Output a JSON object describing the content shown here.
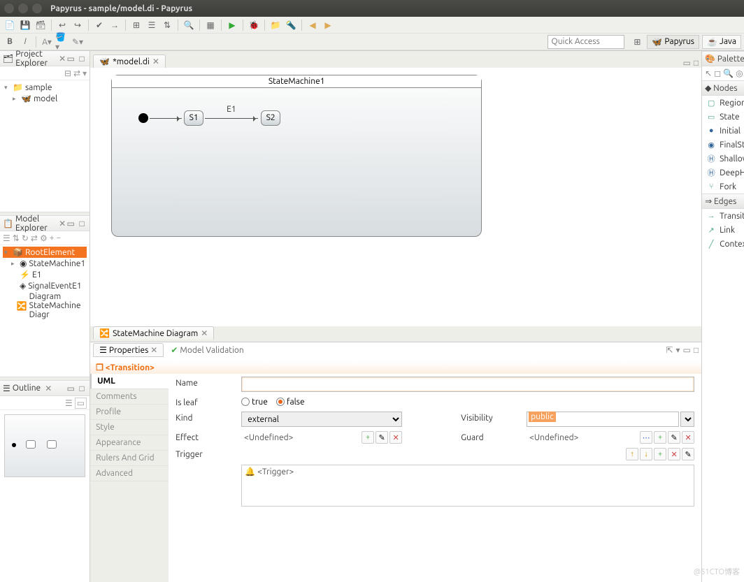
{
  "window": {
    "title": "Papyrus - sample/model.di - Papyrus"
  },
  "toolbar2": {
    "bold": "B",
    "italic": "I",
    "quick_access_placeholder": "Quick Access"
  },
  "perspectives": {
    "papyrus": "Papyrus",
    "java": "Java"
  },
  "project_explorer": {
    "title": "Project Explorer",
    "items": {
      "root": "sample",
      "child": "model"
    }
  },
  "model_explorer": {
    "title": "Model Explorer",
    "items": {
      "root": "RootElement",
      "sm": "StateMachine1",
      "e1": "E1",
      "sig": "SignalEventE1",
      "diag": "Diagram StateMachine Diagr"
    }
  },
  "outline": {
    "title": "Outline"
  },
  "editor": {
    "tab": "*model.di",
    "sm_title": "StateMachine1",
    "s1": "S1",
    "s2": "S2",
    "edge": "E1",
    "bottom_tab": "StateMachine Diagram"
  },
  "bottom": {
    "properties_tab": "Properties",
    "validation_tab": "Model Validation",
    "heading": "<Transition>",
    "cats": {
      "uml": "UML",
      "comments": "Comments",
      "profile": "Profile",
      "style": "Style",
      "appearance": "Appearance",
      "rulers": "Rulers And Grid",
      "advanced": "Advanced"
    },
    "form": {
      "name_label": "Name",
      "name_value": "",
      "isleaf_label": "Is leaf",
      "true_label": "true",
      "false_label": "false",
      "kind_label": "Kind",
      "kind_value": "external",
      "visibility_label": "Visibility",
      "visibility_value": "public",
      "effect_label": "Effect",
      "effect_value": "<Undefined>",
      "guard_label": "Guard",
      "guard_value": "<Undefined>",
      "trigger_label": "Trigger",
      "trigger_item": "<Trigger>"
    }
  },
  "palette": {
    "title": "Palette",
    "nodes_title": "Nodes",
    "nodes": {
      "region": "Region",
      "state": "State",
      "initial": "Initial",
      "final": "FinalState",
      "shallow": "ShallowHistory",
      "deep": "DeepHistory",
      "fork": "Fork"
    },
    "edges_title": "Edges",
    "edges": {
      "transition": "Transition",
      "link": "Link",
      "context": "ContextLink"
    }
  },
  "watermark": "@51CTO博客"
}
